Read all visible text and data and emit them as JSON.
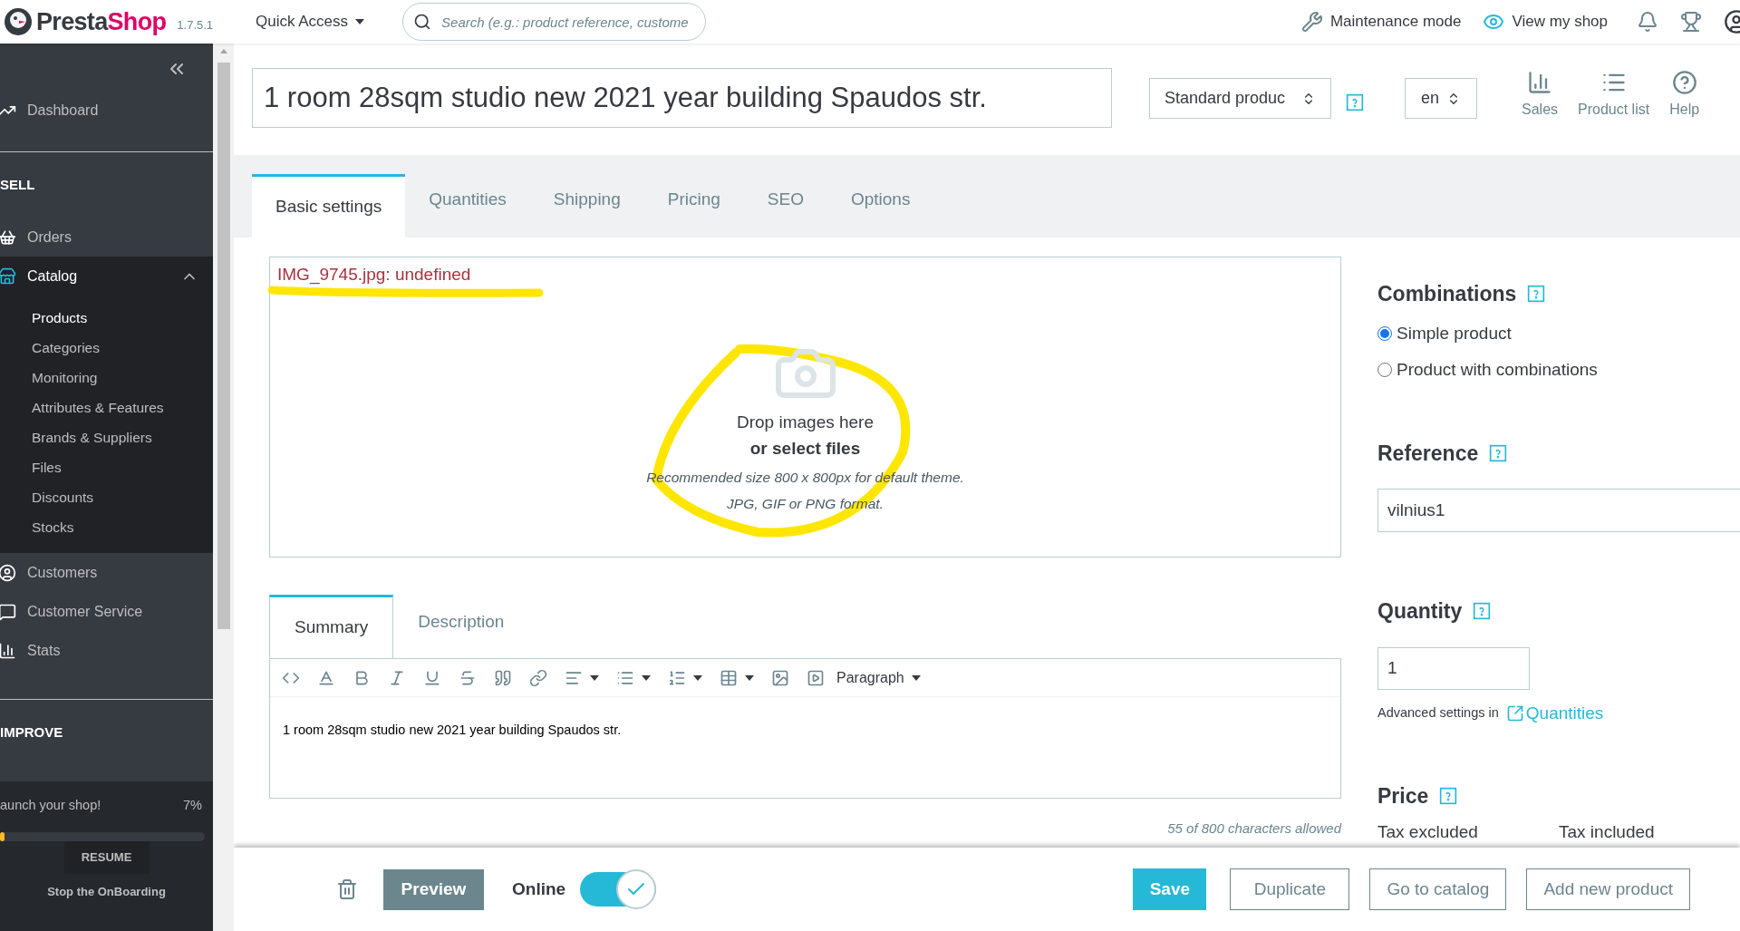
{
  "header": {
    "logo_parts": [
      "Presta",
      "Shop"
    ],
    "version": "1.7.5.1",
    "quick_access": "Quick Access",
    "search": {
      "placeholder": "Search (e.g.: product reference, custome"
    },
    "links": [
      "Maintenance mode",
      "View my shop"
    ]
  },
  "sidebar": {
    "items": [
      {
        "kind": "item",
        "label": "Dashboard",
        "expanded": false
      },
      {
        "kind": "section",
        "label": "SELL"
      },
      {
        "kind": "item",
        "label": "Orders",
        "expanded": false
      },
      {
        "kind": "item",
        "label": "Catalog",
        "expanded": true,
        "children": [
          {
            "label": "Products",
            "selected": true
          },
          {
            "label": "Categories",
            "selected": false
          },
          {
            "label": "Monitoring",
            "selected": false
          },
          {
            "label": "Attributes & Features",
            "selected": false
          },
          {
            "label": "Brands & Suppliers",
            "selected": false
          },
          {
            "label": "Files",
            "selected": false
          },
          {
            "label": "Discounts",
            "selected": false
          },
          {
            "label": "Stocks",
            "selected": false
          }
        ]
      },
      {
        "kind": "item",
        "label": "Customers",
        "expanded": false
      },
      {
        "kind": "item",
        "label": "Customer Service",
        "expanded": false
      },
      {
        "kind": "item",
        "label": "Stats",
        "expanded": false
      },
      {
        "kind": "section",
        "label": "IMPROVE"
      }
    ]
  },
  "onboarding": {
    "title": "aunch your shop!",
    "percent": "7%",
    "level": 0.02,
    "resume": "RESUME",
    "stop": "Stop the OnBoarding"
  },
  "product": {
    "name": "1 room 28sqm studio new 2021 year building Spaudos str.",
    "type": "Standard produc",
    "language": "en"
  },
  "toolbar": [
    "Sales",
    "Product list",
    "Help"
  ],
  "tabs": [
    {
      "label": "Basic settings",
      "selected": true
    },
    {
      "label": "Quantities",
      "selected": false
    },
    {
      "label": "Shipping",
      "selected": false
    },
    {
      "label": "Pricing",
      "selected": false
    },
    {
      "label": "SEO",
      "selected": false
    },
    {
      "label": "Options",
      "selected": false
    }
  ],
  "images": {
    "error": "IMG_9745.jpg: undefined",
    "drop": "Drop images here",
    "select": "or select files",
    "hints": [
      "Recommended size 800 x 800px for default theme.",
      "JPG, GIF or PNG format."
    ]
  },
  "editor": {
    "tabs": [
      {
        "label": "Summary",
        "selected": true
      },
      {
        "label": "Description",
        "selected": false
      }
    ],
    "format": "Paragraph",
    "content": "1 room 28sqm studio new 2021 year building Spaudos str.",
    "counter": "55 of 800 characters allowed"
  },
  "combinations": {
    "title": "Combinations",
    "options": [
      {
        "label": "Simple product",
        "selected": true
      },
      {
        "label": "Product with combinations",
        "selected": false
      }
    ]
  },
  "reference": {
    "title": "Reference",
    "value": "vilnius1"
  },
  "quantity": {
    "title": "Quantity",
    "value": "1",
    "advanced": "Advanced settings in",
    "link": "Quantities"
  },
  "price": {
    "title": "Price",
    "columns": [
      "Tax excluded",
      "Tax included"
    ]
  },
  "footer": {
    "preview": "Preview",
    "online": {
      "label": "Online",
      "on": true
    },
    "buttons": [
      {
        "label": "Save",
        "kind": "primary"
      },
      {
        "label": "Duplicate",
        "kind": "outline"
      },
      {
        "label": "Go to catalog",
        "kind": "outline"
      },
      {
        "label": "Add new product",
        "kind": "outline"
      }
    ]
  }
}
